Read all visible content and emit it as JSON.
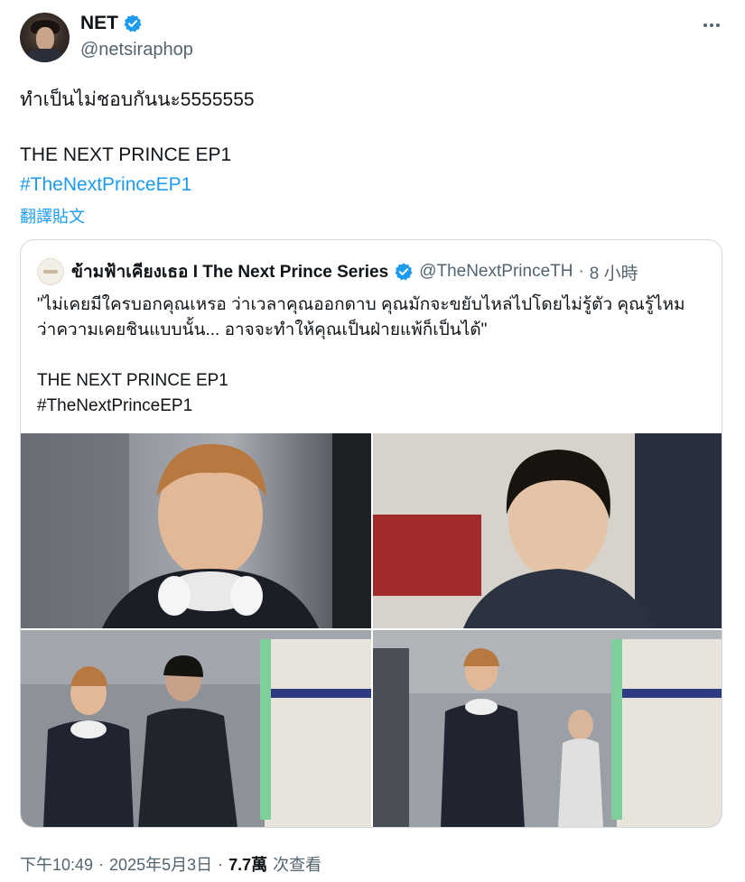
{
  "author": {
    "name": "NET",
    "handle": "@netsiraphop",
    "verified": true,
    "avatar_icon": "profile-photo"
  },
  "more_icon": "more-options-icon",
  "tweet": {
    "line1": "ทำเป็นไม่ชอบกันนะ5555555",
    "line2": "THE NEXT PRINCE EP1",
    "hashtag": "#TheNextPrinceEP1",
    "translate_label": "翻譯貼文"
  },
  "quote": {
    "name": "ข้ามฟ้าเคียงเธอ I The Next Prince Series",
    "handle": "@TheNextPrinceTH",
    "dot": "·",
    "time": "8 小時",
    "verified": true,
    "body_line1": "\"ไม่เคยมีใครบอกคุณเหรอ ว่าเวลาคุณออกดาบ คุณมักจะขยับไหล่ไปโดยไม่รู้ตัว คุณรู้ไหม",
    "body_line2": "ว่าความเคยชินแบบนั้น... อาจจะทำให้คุณเป็นฝ่ายแพ้ก็เป็นได้\"",
    "body_line3": "THE NEXT PRINCE EP1",
    "body_line4": "#TheNextPrinceEP1"
  },
  "media": [
    {
      "alt": "photo-1"
    },
    {
      "alt": "photo-2"
    },
    {
      "alt": "photo-3"
    },
    {
      "alt": "photo-4"
    }
  ],
  "footer": {
    "time": "下午10:49",
    "dot1": "·",
    "date": "2025年5月3日",
    "dot2": "·",
    "views_count": "7.7萬",
    "views_label": "次查看"
  },
  "colors": {
    "accent": "#1d9bf0",
    "text": "#0f1419",
    "secondary": "#536471",
    "border": "#cfd9de"
  }
}
